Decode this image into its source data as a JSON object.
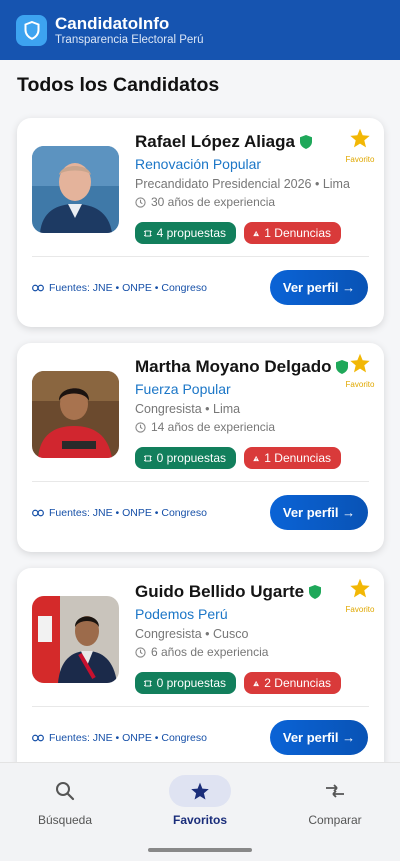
{
  "app": {
    "title": "CandidatoInfo",
    "subtitle": "Transparencia Electoral Perú"
  },
  "page_title": "Todos los Candidatos",
  "candidates": [
    {
      "name": "Rafael López Aliaga",
      "party": "Renovación Popular",
      "role": "Precandidato Presidencial 2026 • Lima",
      "experience": "30 años de experiencia",
      "proposals": "4 propuestas",
      "complaints": "1 Denuncias",
      "favorite_label": "Favorito",
      "sources": "Fuentes: JNE • ONPE • Congreso",
      "cta": "Ver perfil →"
    },
    {
      "name": "Martha Moyano Delgado",
      "party": "Fuerza Popular",
      "role": "Congresista • Lima",
      "experience": "14 años de experiencia",
      "proposals": "0 propuestas",
      "complaints": "1 Denuncias",
      "favorite_label": "Favorito",
      "sources": "Fuentes: JNE • ONPE • Congreso",
      "cta": "Ver perfil →"
    },
    {
      "name": "Guido Bellido Ugarte",
      "party": "Podemos Perú",
      "role": "Congresista • Cusco",
      "experience": "6 años de experiencia",
      "proposals": "0 propuestas",
      "complaints": "2 Denuncias",
      "favorite_label": "Favorito",
      "sources": "Fuentes: JNE • ONPE • Congreso",
      "cta": "Ver perfil →"
    }
  ],
  "nav": [
    {
      "label": "Búsqueda",
      "icon": "search-icon",
      "active": false
    },
    {
      "label": "Favoritos",
      "icon": "star-icon",
      "active": true
    },
    {
      "label": "Comparar",
      "icon": "compare-icon",
      "active": false
    }
  ],
  "colors": {
    "brand": "#1654b0",
    "accent": "#1b76c7",
    "success": "#127f5c",
    "danger": "#d93a3a",
    "favorite": "#f2b705"
  }
}
